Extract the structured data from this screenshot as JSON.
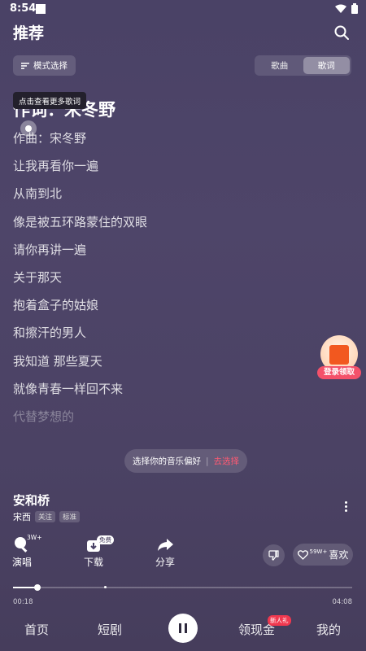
{
  "status_bar": {
    "time": "8:54"
  },
  "header": {
    "title": "推荐"
  },
  "mode_select": {
    "label": "模式选择"
  },
  "segmented": {
    "items": [
      {
        "label": "歌曲"
      },
      {
        "label": "歌词"
      }
    ],
    "active": "歌词"
  },
  "tooltip": {
    "text": "点击查看更多歌词"
  },
  "lyrics": {
    "current": "作词：宋冬野",
    "lines": [
      "作曲：宋冬野",
      "让我再看你一遍",
      "从南到北",
      "像是被五环路蒙住的双眼",
      "请你再讲一遍",
      "关于那天",
      "抱着盒子的姑娘",
      "和擦汗的男人",
      "我知道 那些夏天",
      "就像青春一样回不来",
      "代替梦想的"
    ]
  },
  "gift": {
    "label": "登录领取"
  },
  "preferences": {
    "text": "选择你的音乐偏好",
    "separator": "|",
    "action": "去选择"
  },
  "song": {
    "title": "安和桥",
    "artist": "宋西",
    "follow_tag": "关注",
    "quality_tag": "标准"
  },
  "actions": {
    "sing": {
      "label": "演唱",
      "count": "3W+"
    },
    "download": {
      "label": "下载",
      "badge": "免费"
    },
    "share": {
      "label": "分享"
    },
    "like": {
      "label": "喜欢",
      "count": "59W+"
    }
  },
  "player": {
    "current_time": "00:18",
    "total_time": "04:08",
    "progress": 0.0726,
    "marker_position": 0.2684
  },
  "tabbar": {
    "tabs": [
      {
        "label": "首页"
      },
      {
        "label": "短剧"
      },
      {
        "label": "领现金"
      },
      {
        "label": "我的"
      }
    ],
    "cash_badge": "新人礼"
  },
  "colors": {
    "accent": "#ff5a73",
    "badge": "#f0384f",
    "background": "#4b4264"
  },
  "icons": [
    "search-icon",
    "list-icon",
    "microphone-icon",
    "download-icon",
    "share-icon",
    "thumbs-down-icon",
    "heart-icon",
    "more-vertical-icon",
    "pause-icon",
    "gift-icon"
  ]
}
